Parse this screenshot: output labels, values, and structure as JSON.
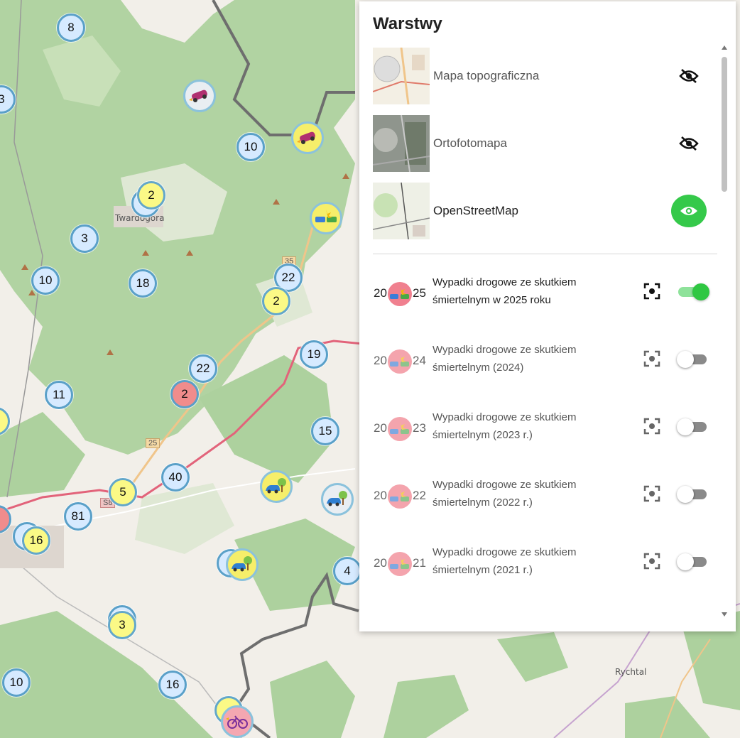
{
  "map": {
    "place_labels": [
      {
        "text": "Twardogóra"
      },
      {
        "text": "Rychtal"
      }
    ],
    "road_labels": [
      {
        "text": "35",
        "color": "orange"
      },
      {
        "text": "25",
        "color": "orange"
      },
      {
        "text": "S8",
        "color": "red"
      }
    ],
    "clusters": [
      {
        "label": "8",
        "color": "blue"
      },
      {
        "label": "3",
        "color": "blue"
      },
      {
        "label": "10",
        "color": "blue"
      },
      {
        "label": "2",
        "color": "yellow"
      },
      {
        "label": "3",
        "color": "blue"
      },
      {
        "label": "10",
        "color": "blue"
      },
      {
        "label": "18",
        "color": "blue"
      },
      {
        "label": "22",
        "color": "blue"
      },
      {
        "label": "2",
        "color": "yellow"
      },
      {
        "label": "19",
        "color": "blue"
      },
      {
        "label": "22",
        "color": "blue"
      },
      {
        "label": "2",
        "color": "red"
      },
      {
        "label": "11",
        "color": "blue"
      },
      {
        "label": "15",
        "color": "blue"
      },
      {
        "label": "40",
        "color": "blue"
      },
      {
        "label": "5",
        "color": "yellow"
      },
      {
        "label": "81",
        "color": "blue"
      },
      {
        "label": "16",
        "color": "yellow"
      },
      {
        "label": "4",
        "color": "blue"
      },
      {
        "label": "3",
        "color": "yellow"
      },
      {
        "label": "10",
        "color": "blue"
      },
      {
        "label": "16",
        "color": "blue"
      }
    ],
    "accident_markers": [
      {
        "icon": "overturned-car-icon"
      },
      {
        "icon": "overturned-car-icon"
      },
      {
        "icon": "car-collision-icon"
      },
      {
        "icon": "car-tree-crash-icon"
      },
      {
        "icon": "car-tree-crash-icon"
      },
      {
        "icon": "car-tree-crash-icon"
      },
      {
        "icon": "bicycle-crash-icon"
      }
    ]
  },
  "panel": {
    "title": "Warstwy",
    "base_layers": [
      {
        "name": "Mapa topograficzna",
        "visible": false,
        "icon": "eye-slash-icon"
      },
      {
        "name": "Ortofotomapa",
        "visible": false,
        "icon": "eye-slash-icon"
      },
      {
        "name": "OpenStreetMap",
        "visible": true,
        "icon": "eye-icon"
      }
    ],
    "overlays": [
      {
        "year_left": "20",
        "year_right": "25",
        "name": "Wypadki drogowe ze skutkiem śmiertelnym w 2025 roku",
        "enabled": true
      },
      {
        "year_left": "20",
        "year_right": "24",
        "name": "Wypadki drogowe ze skutkiem śmiertelnym (2024)",
        "enabled": false
      },
      {
        "year_left": "20",
        "year_right": "23",
        "name": "Wypadki drogowe ze skutkiem śmiertelnym (2023 r.)",
        "enabled": false
      },
      {
        "year_left": "20",
        "year_right": "22",
        "name": "Wypadki drogowe ze skutkiem śmiertelnym (2022 r.)",
        "enabled": false
      },
      {
        "year_left": "20",
        "year_right": "21",
        "name": "Wypadki drogowe ze skutkiem śmiertelnym (2021 r.)",
        "enabled": false
      }
    ]
  },
  "colors": {
    "active_eye": "#35c94a",
    "toggle_on": "#2fc742",
    "cluster_blue": "#d6eaff",
    "cluster_yellow": "#fbf986",
    "cluster_red": "#f08c8c"
  }
}
